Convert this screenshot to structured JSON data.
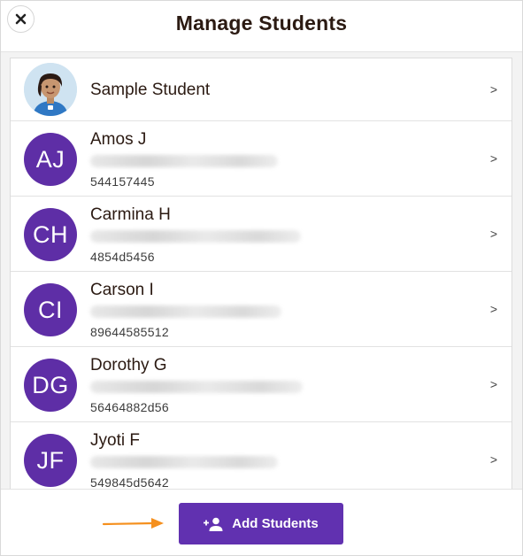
{
  "header": {
    "title": "Manage Students",
    "close_icon": "close-icon"
  },
  "students": [
    {
      "name": "Sample Student",
      "initials": "",
      "code": "",
      "avatar": "sample-student-avatar",
      "detail_blurred": false
    },
    {
      "name": "Amos J",
      "initials": "AJ",
      "code": "544157445",
      "detail_blurred": true
    },
    {
      "name": "Carmina H",
      "initials": "CH",
      "code": "4854d5456",
      "detail_blurred": true
    },
    {
      "name": "Carson I",
      "initials": "CI",
      "code": "89644585512",
      "detail_blurred": true
    },
    {
      "name": "Dorothy G",
      "initials": "DG",
      "code": "56464882d56",
      "detail_blurred": true
    },
    {
      "name": "Jyoti F",
      "initials": "JF",
      "code": "549845d5642",
      "detail_blurred": true
    }
  ],
  "row_chevron": ">",
  "footer": {
    "add_label": "Add Students",
    "add_icon": "add-person-icon",
    "pointer_icon": "orange-arrow-icon"
  },
  "colors": {
    "accent": "#6131b0",
    "avatar_bg": "#5e2ea6",
    "arrow": "#f5901e",
    "title_text": "#2b1a12"
  }
}
